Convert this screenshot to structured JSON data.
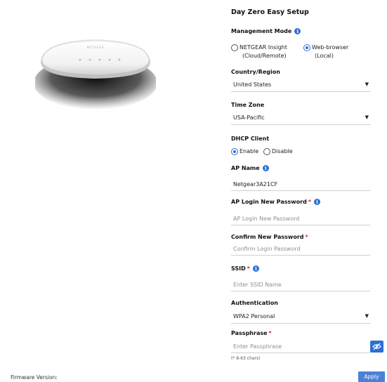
{
  "device": {
    "brand_text": "NETGEAR"
  },
  "form": {
    "title": "Day Zero Easy Setup",
    "management_mode": {
      "label": "Management Mode",
      "options": [
        {
          "line1": "NETGEAR Insight",
          "line2": "(Cloud/Remote)",
          "selected": false
        },
        {
          "line1": "Web-browser",
          "line2": "(Local)",
          "selected": true
        }
      ]
    },
    "country": {
      "label": "Country/Region",
      "value": "United States"
    },
    "timezone": {
      "label": "Time Zone",
      "value": "USA-Pacific"
    },
    "dhcp": {
      "label": "DHCP Client",
      "options": [
        {
          "text": "Enable",
          "selected": true
        },
        {
          "text": "Disable",
          "selected": false
        }
      ]
    },
    "ap_name": {
      "label": "AP Name",
      "value": "Netgear3A21CF"
    },
    "ap_password": {
      "label": "AP Login New Password",
      "placeholder": "AP Login New Password"
    },
    "confirm_password": {
      "label": "Confirm New Password",
      "placeholder": "Confirm Login Password"
    },
    "ssid": {
      "label": "SSID",
      "placeholder": "Enter SSID Name"
    },
    "authentication": {
      "label": "Authentication",
      "value": "WPA2 Personal"
    },
    "passphrase": {
      "label": "Passphrase",
      "placeholder": "Enter Passphrase",
      "hint": "(* 8-63 chars)"
    },
    "required_mark": "*",
    "info_glyph": "i",
    "caret_glyph": "▼"
  },
  "footer": {
    "firmware_label": "Firmware Version:",
    "apply_label": "Apply"
  },
  "colors": {
    "accent": "#2d6fd4",
    "apply_bg": "#4b80d6",
    "required": "#e0261c"
  }
}
